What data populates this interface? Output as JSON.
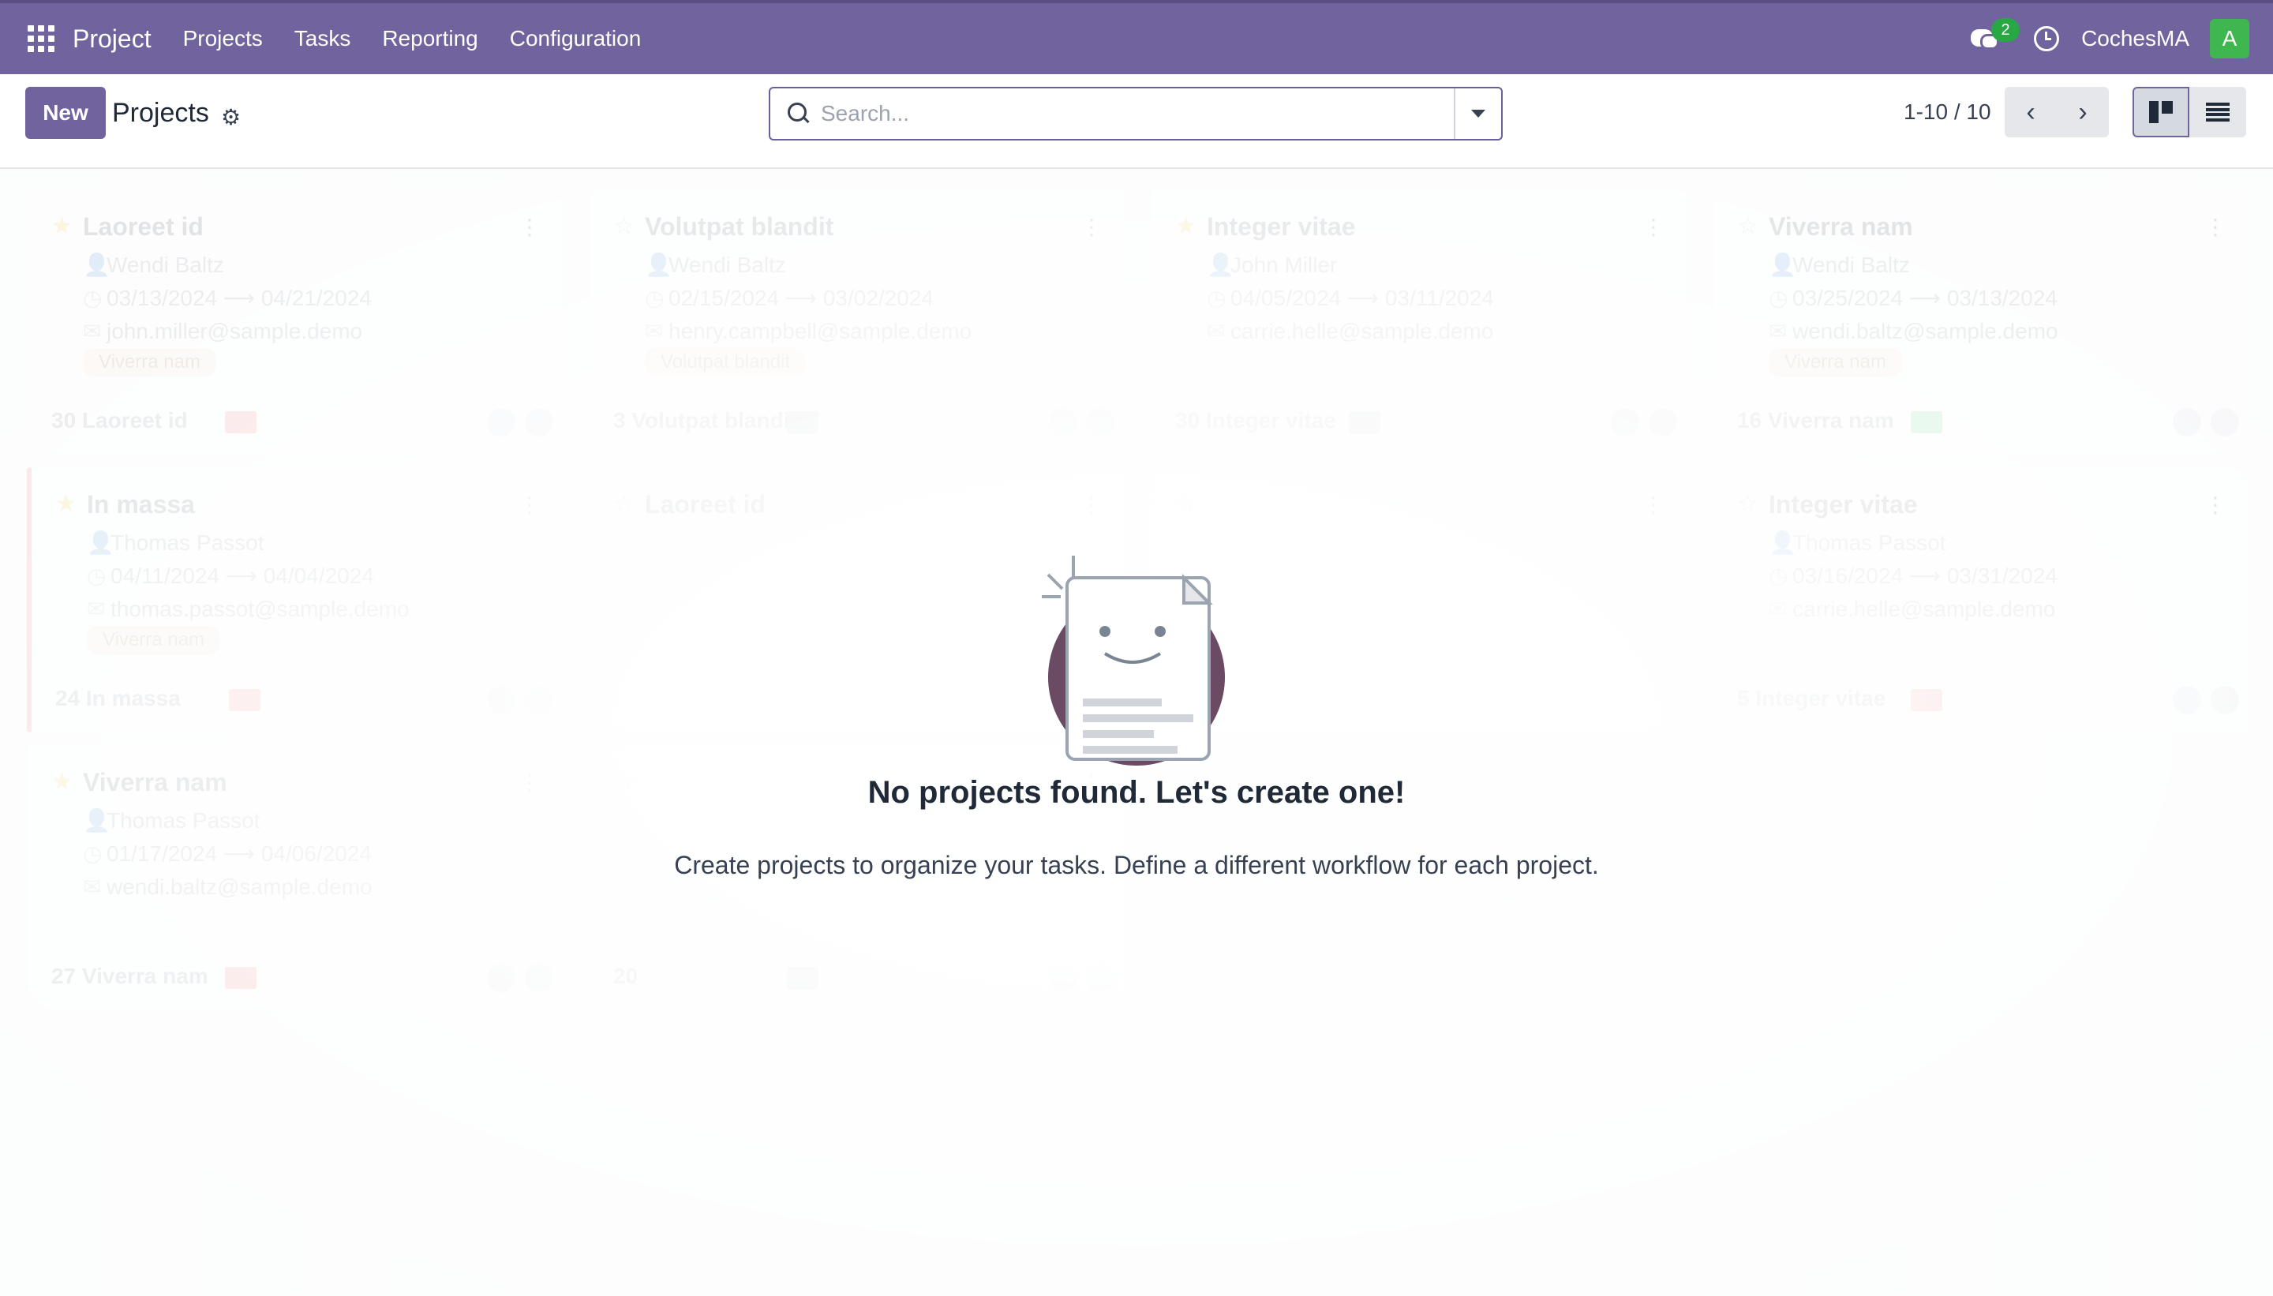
{
  "navbar": {
    "brand": "Project",
    "menu": [
      "Projects",
      "Tasks",
      "Reporting",
      "Configuration"
    ],
    "message_count": "2",
    "company": "CochesMA",
    "avatar_letter": "A"
  },
  "control": {
    "new_label": "New",
    "title": "Projects",
    "search_placeholder": "Search...",
    "pager": "1-10 / 10"
  },
  "ghost_cards": [
    {
      "title": "Laoreet id",
      "user": "Wendi Baltz",
      "start": "03/13/2024",
      "end": "04/21/2024",
      "email": "john.miller@sample.demo",
      "tag": "Viverra nam",
      "footer": "30 Laoreet id",
      "starred": true
    },
    {
      "title": "Volutpat blandit",
      "user": "Wendi Baltz",
      "start": "02/15/2024",
      "end": "03/02/2024",
      "email": "henry.campbell@sample.demo",
      "tag": "Volutpat blandit",
      "footer": "3 Volutpat blandit",
      "starred": false
    },
    {
      "title": "Integer vitae",
      "user": "John Miller",
      "start": "04/05/2024",
      "end": "03/11/2024",
      "email": "carrie.helle@sample.demo",
      "tag": "",
      "footer": "30 Integer vitae",
      "starred": true
    },
    {
      "title": "Viverra nam",
      "user": "Wendi Baltz",
      "start": "03/25/2024",
      "end": "03/13/2024",
      "email": "wendi.baltz@sample.demo",
      "tag": "Viverra nam",
      "footer": "16 Viverra nam",
      "starred": false
    },
    {
      "title": "In massa",
      "user": "Thomas Passot",
      "start": "04/11/2024",
      "end": "04/04/2024",
      "email": "thomas.passot@sample.demo",
      "tag": "Viverra nam",
      "footer": "24 In massa",
      "starred": true
    },
    {
      "title": "Laoreet id",
      "user": "",
      "start": "",
      "end": "",
      "email": "",
      "tag": "",
      "footer": "",
      "starred": false
    },
    {
      "title": "",
      "user": "",
      "start": "",
      "end": "",
      "email": "",
      "tag": "",
      "footer": "",
      "starred": false
    },
    {
      "title": "Integer vitae",
      "user": "Thomas Passot",
      "start": "03/16/2024",
      "end": "03/31/2024",
      "email": "carrie.helle@sample.demo",
      "tag": "",
      "footer": "5 Integer vitae",
      "starred": false
    },
    {
      "title": "Viverra nam",
      "user": "Thomas Passot",
      "start": "01/17/2024",
      "end": "04/06/2024",
      "email": "wendi.baltz@sample.demo",
      "tag": "",
      "footer": "27 Viverra nam",
      "starred": true
    },
    {
      "title": "",
      "user": "",
      "start": "",
      "end": "",
      "email": "",
      "tag": "",
      "footer": "20",
      "starred": false
    }
  ],
  "helper": {
    "title": "No projects found. Let's create one!",
    "description": "Create projects to organize your tasks. Define a different workflow for each project."
  },
  "colors": {
    "brand": "#71639e",
    "badge": "#28a745",
    "avatar": "#3fb650"
  }
}
